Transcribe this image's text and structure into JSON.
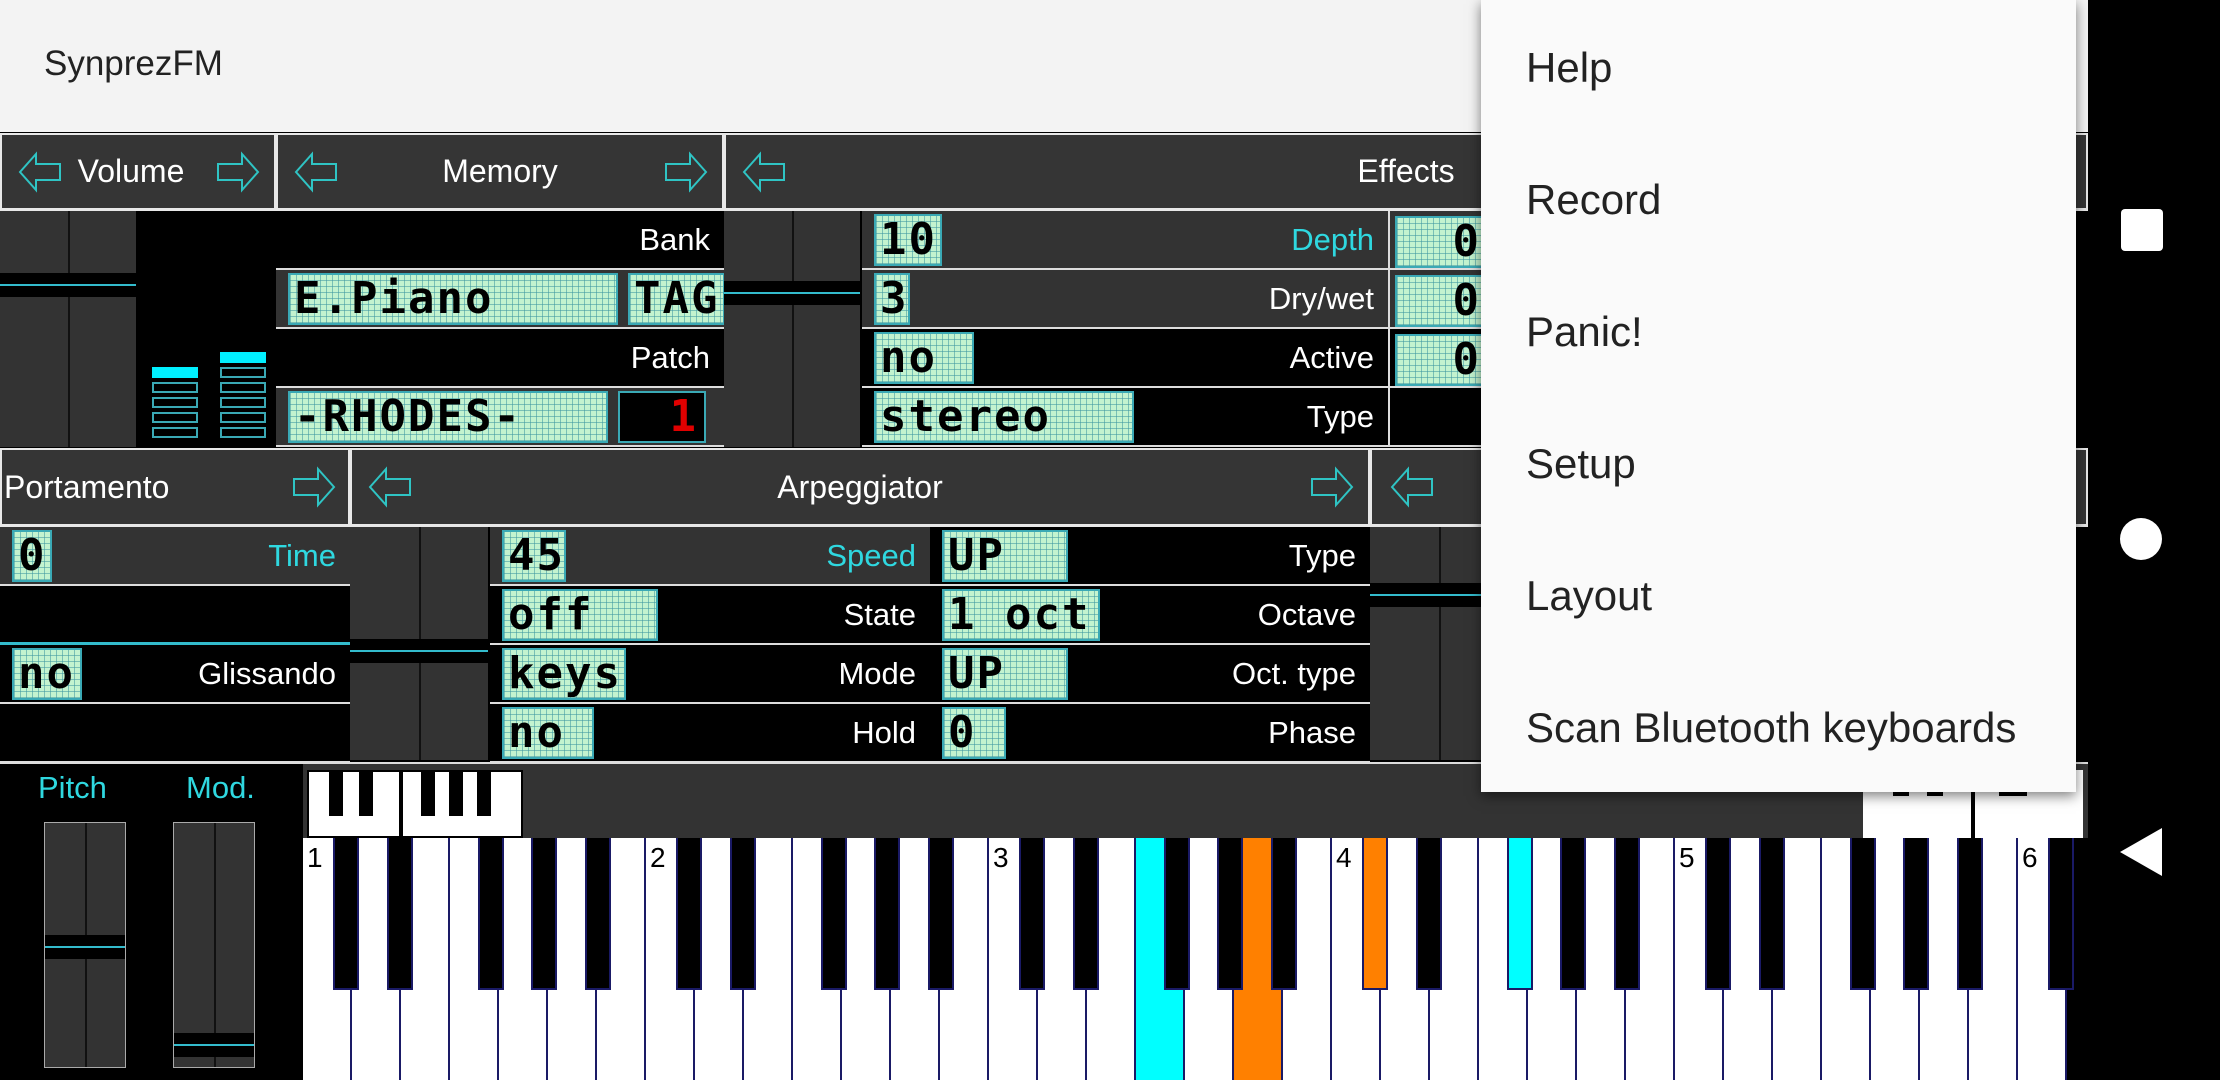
{
  "app": {
    "title": "SynprezFM"
  },
  "colors": {
    "accent": "#2fd8e0",
    "lcd": "#c3f3cf",
    "panel": "#353535",
    "pressed_cyan": "#00ffff",
    "pressed_orange": "#ff8000"
  },
  "panels": [
    {
      "id": "volume",
      "title": "Volume",
      "rows": []
    },
    {
      "id": "memory",
      "title": "Memory",
      "rows": [
        {
          "label": "Bank",
          "value": ""
        },
        {
          "value": "E.Piano",
          "value2": "TAG",
          "label": ""
        },
        {
          "label": "Patch",
          "value": ""
        },
        {
          "value": "-RHODES-",
          "digit": "1",
          "label": ""
        }
      ]
    },
    {
      "id": "effects",
      "title": "Effects",
      "rows": [
        {
          "value": "10",
          "label": "Depth",
          "accent": true,
          "value2": "0"
        },
        {
          "value": "3",
          "label": "Dry/wet",
          "value2": "0"
        },
        {
          "value": "no",
          "label": "Active",
          "value2": "0"
        },
        {
          "value": "stereo",
          "label": "Type"
        }
      ]
    },
    {
      "id": "portamento",
      "title": "Portamento",
      "rows": [
        {
          "value": "0",
          "label": "Time",
          "accent": true
        },
        {
          "value": "",
          "label": ""
        },
        {
          "value": "no",
          "label": "Glissando"
        },
        {
          "value": "",
          "label": ""
        }
      ]
    },
    {
      "id": "arpeggiator",
      "title": "Arpeggiator",
      "rows": [
        {
          "value": "45",
          "label": "Speed",
          "accent": true
        },
        {
          "value": "off",
          "label": "State"
        },
        {
          "value": "keys",
          "label": "Mode"
        },
        {
          "value": "no",
          "label": "Hold"
        }
      ],
      "rows2": [
        {
          "value": "UP",
          "label": "Type"
        },
        {
          "value": "1 oct",
          "label": "Octave"
        },
        {
          "value": "UP",
          "label": "Oct. type"
        },
        {
          "value": "0",
          "label": "Phase"
        }
      ]
    }
  ],
  "controllers": {
    "pitch_label": "Pitch",
    "mod_label": "Mod."
  },
  "keyboard": {
    "octave_labels": [
      "1",
      "2",
      "3",
      "4",
      "5",
      "6"
    ],
    "pressed": [
      {
        "note": "F3",
        "color": "cyan"
      },
      {
        "note": "A3",
        "color": "orange"
      },
      {
        "note": "C#4",
        "color": "orange"
      },
      {
        "note": "F#4",
        "color": "cyan"
      }
    ]
  },
  "menu": {
    "items": [
      "Help",
      "Record",
      "Panic!",
      "Setup",
      "Layout",
      "Scan Bluetooth keyboards"
    ]
  },
  "navbar": {
    "icons": [
      "recents-icon",
      "home-icon",
      "back-icon"
    ]
  }
}
